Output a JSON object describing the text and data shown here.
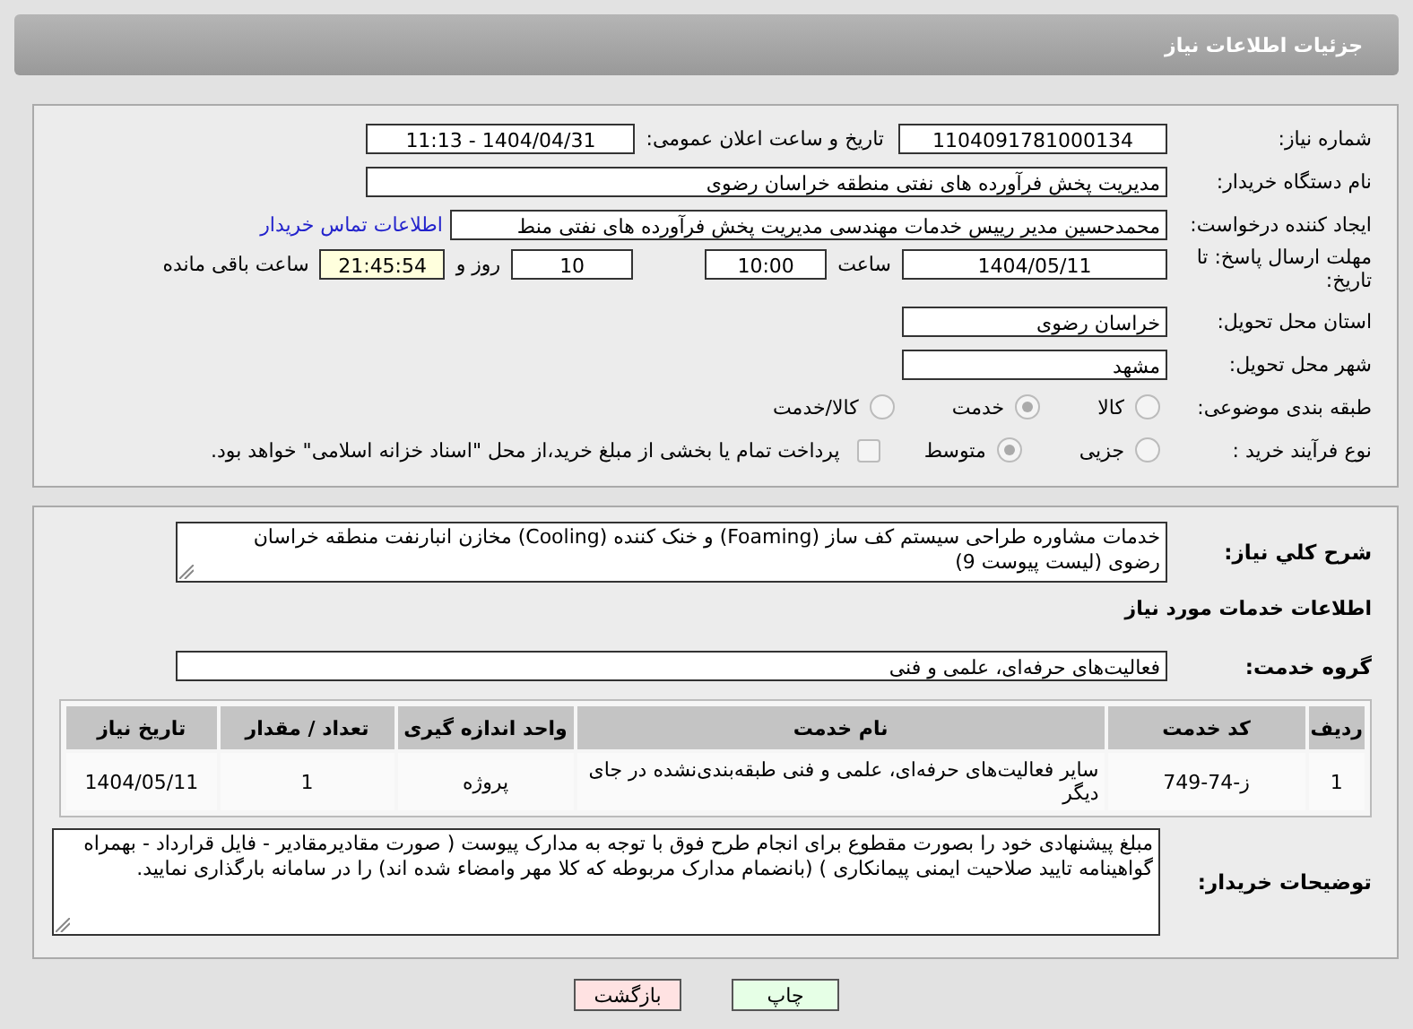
{
  "header": {
    "title": "جزئیات اطلاعات نیاز"
  },
  "need_number": {
    "label": "شماره نیاز:",
    "value": "1104091781000134"
  },
  "announce": {
    "label": "تاریخ و ساعت اعلان عمومی:",
    "value": "1404/04/31 - 11:13"
  },
  "buyer": {
    "label": "نام دستگاه خریدار:",
    "value": "مدیریت پخش فرآورده های نفتی منطقه خراسان رضوی"
  },
  "creator": {
    "label": "ایجاد کننده درخواست:",
    "value": "محمدحسین مدیر رییس خدمات مهندسی مدیریت پخش فرآورده های نفتی منط",
    "link": "اطلاعات تماس خریدار"
  },
  "deadline": {
    "label": "مهلت ارسال پاسخ: تا تاریخ:",
    "date": "1404/05/11",
    "time_label": "ساعت",
    "time": "10:00",
    "days": "10",
    "days_label": "روز و",
    "remaining": "21:45:54",
    "remaining_label": "ساعت باقی مانده"
  },
  "province": {
    "label": "استان محل تحویل:",
    "value": "خراسان رضوی"
  },
  "city": {
    "label": "شهر محل تحویل:",
    "value": "مشهد"
  },
  "category": {
    "label": "طبقه بندی موضوعی:",
    "options": [
      {
        "label": "کالا",
        "selected": false
      },
      {
        "label": "خدمت",
        "selected": true
      },
      {
        "label": "کالا/خدمت",
        "selected": false
      }
    ]
  },
  "process": {
    "label": "نوع فرآیند خرید :",
    "options": [
      {
        "label": "جزیی",
        "selected": false
      },
      {
        "label": "متوسط",
        "selected": true
      }
    ],
    "payment": {
      "label": "پرداخت تمام یا بخشی از مبلغ خرید،از محل \"اسناد خزانه اسلامی\" خواهد بود.",
      "checked": false
    }
  },
  "description": {
    "label": "شرح کلي نياز:",
    "value": "خدمات مشاوره طراحی سیستم کف ساز (Foaming) و خنک کننده (Cooling) مخازن انبارنفت منطقه خراسان رضوی (لیست پیوست 9)"
  },
  "services_title": "اطلاعات خدمات مورد نیاز",
  "service_group": {
    "label": "گروه خدمت:",
    "value": "فعالیت‌های حرفه‌ای، علمی و فنی"
  },
  "table": {
    "columns": [
      "ردیف",
      "کد خدمت",
      "نام خدمت",
      "واحد اندازه گیری",
      "تعداد / مقدار",
      "تاریخ نیاز"
    ],
    "rows": [
      [
        "1",
        "ز-74-749",
        "سایر فعالیت‌های حرفه‌ای، علمی و فنی طبقه‌بندی‌نشده در جای دیگر",
        "پروژه",
        "1",
        "1404/05/11"
      ]
    ]
  },
  "buyer_notes": {
    "label": "توضیحات خریدار:",
    "value": "مبلغ پیشنهادی خود را بصورت مقطوع برای انجام طرح فوق با توجه به مدارک پیوست ( صورت مقادیرمقادیر - فایل قرارداد - بهمراه گواهینامه تایید صلاحیت ایمنی پیمانکاری )  (بانضمام مدارک مربوطه که کلا مهر وامضاء شده اند) را در سامانه بارگذاری نمایید."
  },
  "buttons": [
    {
      "label": "چاپ",
      "kind": "print"
    },
    {
      "label": "بازگشت",
      "kind": "back"
    }
  ]
}
